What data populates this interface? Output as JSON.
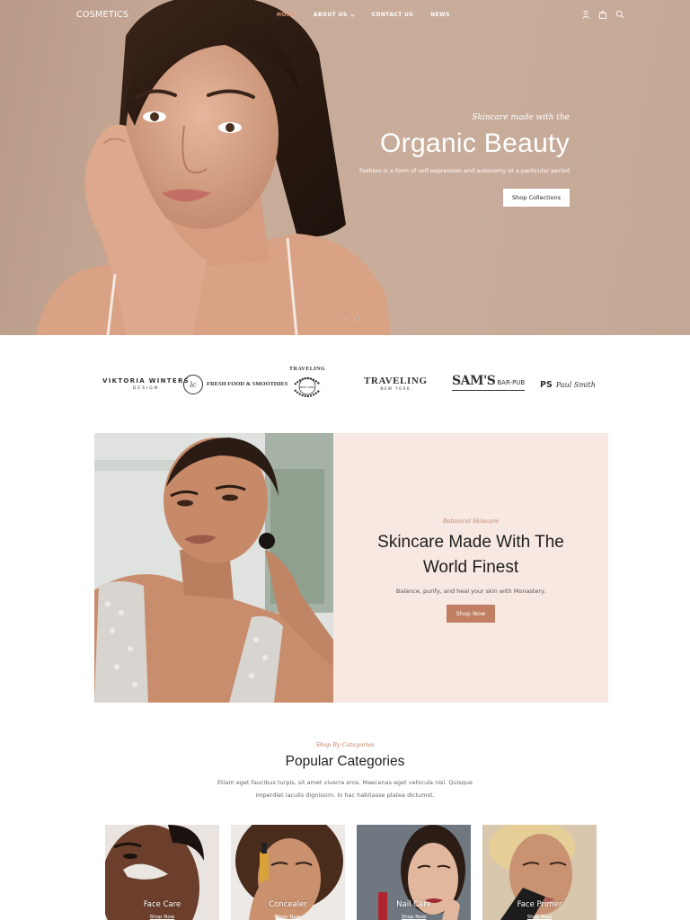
{
  "header": {
    "logo": "COSMETICS",
    "nav": [
      {
        "label": "HOME",
        "active": true
      },
      {
        "label": "ABOUT US",
        "active": false,
        "has_dropdown": true
      },
      {
        "label": "CONTACT US",
        "active": false
      },
      {
        "label": "NEWS",
        "active": false
      }
    ],
    "icons": [
      "user-icon",
      "bag-icon",
      "search-icon"
    ]
  },
  "hero": {
    "tagline": "Skincare made with the",
    "title": "Organic Beauty",
    "description": "Fashion is a form of self-expression and autonomy at a particular period",
    "button": "Shop Collections",
    "slides": 2,
    "active_slide": 1
  },
  "brands": [
    {
      "name": "VIKTORIA WINTERS",
      "sub": "DESIGN"
    },
    {
      "name": "FRESH FOOD & SMOOTHIES",
      "mark": "lc"
    },
    {
      "name": "TRAVELING",
      "sub": "NEW YORK",
      "style": "circular"
    },
    {
      "name": "TRAVELING",
      "sub": "NEW YORK"
    },
    {
      "name": "SAM'S",
      "sub": "BAR-PUB"
    },
    {
      "name": "PS",
      "script": "Paul Smith"
    }
  ],
  "feature": {
    "kicker": "Botanical Skincare",
    "title_line1": "Skincare Made With The",
    "title_line2": "World Finest",
    "description": "Balance, purify, and heal your skin with Monastery.",
    "button": "Shop Now"
  },
  "categories": {
    "kicker": "Shop By Categories",
    "title": "Popular Categories",
    "description_line1": "Etiam eget faucibus turpis, sit amet viverra eros. Maecenas eget vehicula nisl. Quisque",
    "description_line2": "imperdiet iaculis dignissim. In hac habitasse platea dictumst.",
    "items": [
      {
        "title": "Face Care",
        "link": "Shop Now"
      },
      {
        "title": "Concealer",
        "link": "Shop Now"
      },
      {
        "title": "Nail Care",
        "link": "Shop Now"
      },
      {
        "title": "Face Primer",
        "link": "Shop Now"
      }
    ]
  },
  "colors": {
    "accent": "#c07f62",
    "hero_bg": "#c8ab99",
    "feature_panel": "#f7e8e2",
    "nav_active": "#e2a07e"
  }
}
